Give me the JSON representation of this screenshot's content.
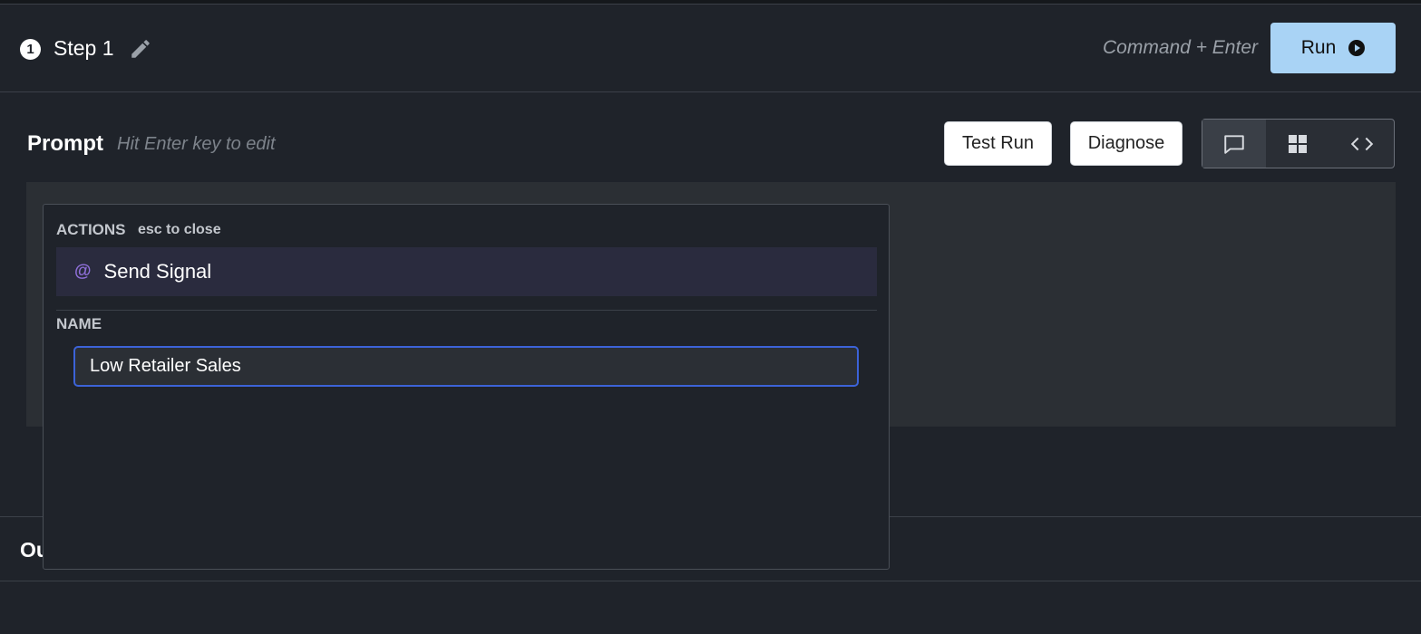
{
  "step": {
    "number": "1",
    "title": "Step 1"
  },
  "header": {
    "shortcut": "Command + Enter",
    "run_label": "Run"
  },
  "prompt": {
    "label": "Prompt",
    "hint": "Hit Enter key to edit"
  },
  "buttons": {
    "test_run": "Test Run",
    "diagnose": "Diagnose"
  },
  "view_modes": {
    "active": "chat",
    "options": [
      "chat",
      "grid",
      "code"
    ]
  },
  "popup": {
    "heading": "ACTIONS",
    "hint": "esc to close",
    "action": {
      "icon": "@",
      "label": "Send Signal"
    },
    "name_label": "NAME",
    "name_value": "Low Retailer Sales"
  },
  "output": {
    "label_visible": "Ou"
  },
  "colors": {
    "accent": "#a9d3f5",
    "focus": "#3c63d8",
    "at_icon": "#8e6fd8"
  }
}
